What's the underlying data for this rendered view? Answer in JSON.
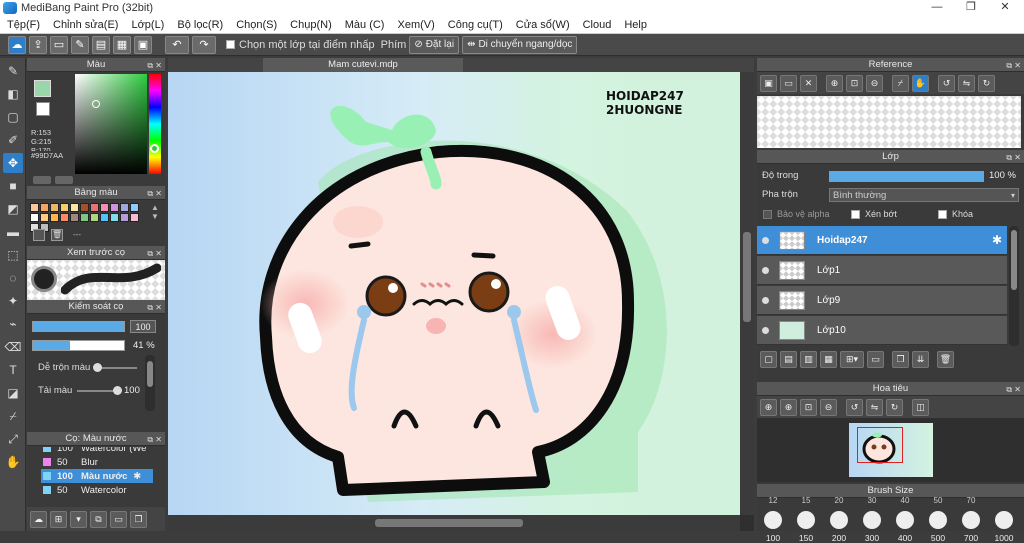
{
  "window": {
    "title": "MediBang Paint Pro (32bit)",
    "min": "—",
    "max": "❐",
    "close": "✕"
  },
  "menu": [
    "Tệp(F)",
    "Chỉnh sửa(E)",
    "Lớp(L)",
    "Bộ lọc(R)",
    "Chọn(S)",
    "Chụp(N)",
    "Màu (C)",
    "Xem(V)",
    "Công cụ(T)",
    "Cửa sổ(W)",
    "Cloud",
    "Help"
  ],
  "toolbar": {
    "select_layer_label": "Chọn một lớp tại điểm nhấp",
    "key_label": "Phím",
    "reset_label": "Đặt lại",
    "move_label": "Di chuyển ngang/dọc"
  },
  "color_panel": {
    "title": "Màu",
    "r": "R:153",
    "g": "G:215",
    "b": "B:170",
    "hex": "#99D7AA",
    "fg": "#99d7aa",
    "bg": "#ffffff"
  },
  "palette_panel": {
    "title": "Bảng màu",
    "dash": "---",
    "swatches": [
      "#f6c89f",
      "#f4a460",
      "#e8b86a",
      "#f2d16b",
      "#f7e8a4",
      "#a0522d",
      "#e57373",
      "#f48fb1",
      "#ce93d8",
      "#9fa8da",
      "#90caf9",
      "#ffffff",
      "#ffcc80",
      "#ffb74d",
      "#ff8a65",
      "#a1887f",
      "#81c784",
      "#aed581",
      "#4fc3f7",
      "#80deea",
      "#b39ddb",
      "#f8bbd0",
      "#e0e0e0",
      "#bdbdbd"
    ]
  },
  "brush_preview": {
    "title": "Xem trước cọ"
  },
  "brush_control": {
    "title": "Kiểm soát cọ",
    "size": "100",
    "opacity": "41 %",
    "blend_label": "Dễ trộn màu",
    "blend_value": "0",
    "paint_label": "Tải màu",
    "paint_value": "100"
  },
  "brush_list": {
    "title": "Cọ: Màu nước",
    "items": [
      {
        "size": "100",
        "name": "Watercolor (We",
        "color": "#7fd3f7"
      },
      {
        "size": "50",
        "name": "Blur",
        "color": "#ee82ee"
      },
      {
        "size": "100",
        "name": "Màu nước",
        "color": "#7fd3f7"
      },
      {
        "size": "50",
        "name": "Watercolor",
        "color": "#7fd3f7"
      }
    ]
  },
  "document": {
    "tab": "Mam cutevi.mdp",
    "watermark_1": "HOIDAP247",
    "watermark_2": "2HUONGNE"
  },
  "reference_panel": {
    "title": "Reference"
  },
  "layer_panel": {
    "title": "Lớp",
    "opacity_label": "Độ trong",
    "opacity_value": "100 %",
    "opacity_fraction": 1.0,
    "blend_label": "Pha trộn",
    "blend_value": "Bình thường",
    "protect_alpha": "Bảo vệ alpha",
    "clipping": "Xén bớt",
    "lock": "Khóa",
    "layers": [
      {
        "name": "Hoidap247",
        "selected": true
      },
      {
        "name": "Lớp1",
        "selected": false
      },
      {
        "name": "Lớp9",
        "selected": false
      },
      {
        "name": "Lớp10",
        "selected": false
      }
    ]
  },
  "navigator_panel": {
    "title": "Hoa tiêu"
  },
  "brush_size_panel": {
    "title": "Brush Size",
    "top_labels": [
      "12",
      "15",
      "20",
      "30",
      "40",
      "50",
      "70"
    ],
    "sizes": [
      "100",
      "150",
      "200",
      "300",
      "400",
      "500",
      "700",
      "1000"
    ]
  },
  "colors": {
    "accent": "#3f8fd8",
    "bg_green": "#d4f3e0",
    "bg_blue": "#b9d9f5",
    "outline": "#0d0d0d",
    "face": "#fde8e1",
    "sprout": "#99f0b4"
  }
}
